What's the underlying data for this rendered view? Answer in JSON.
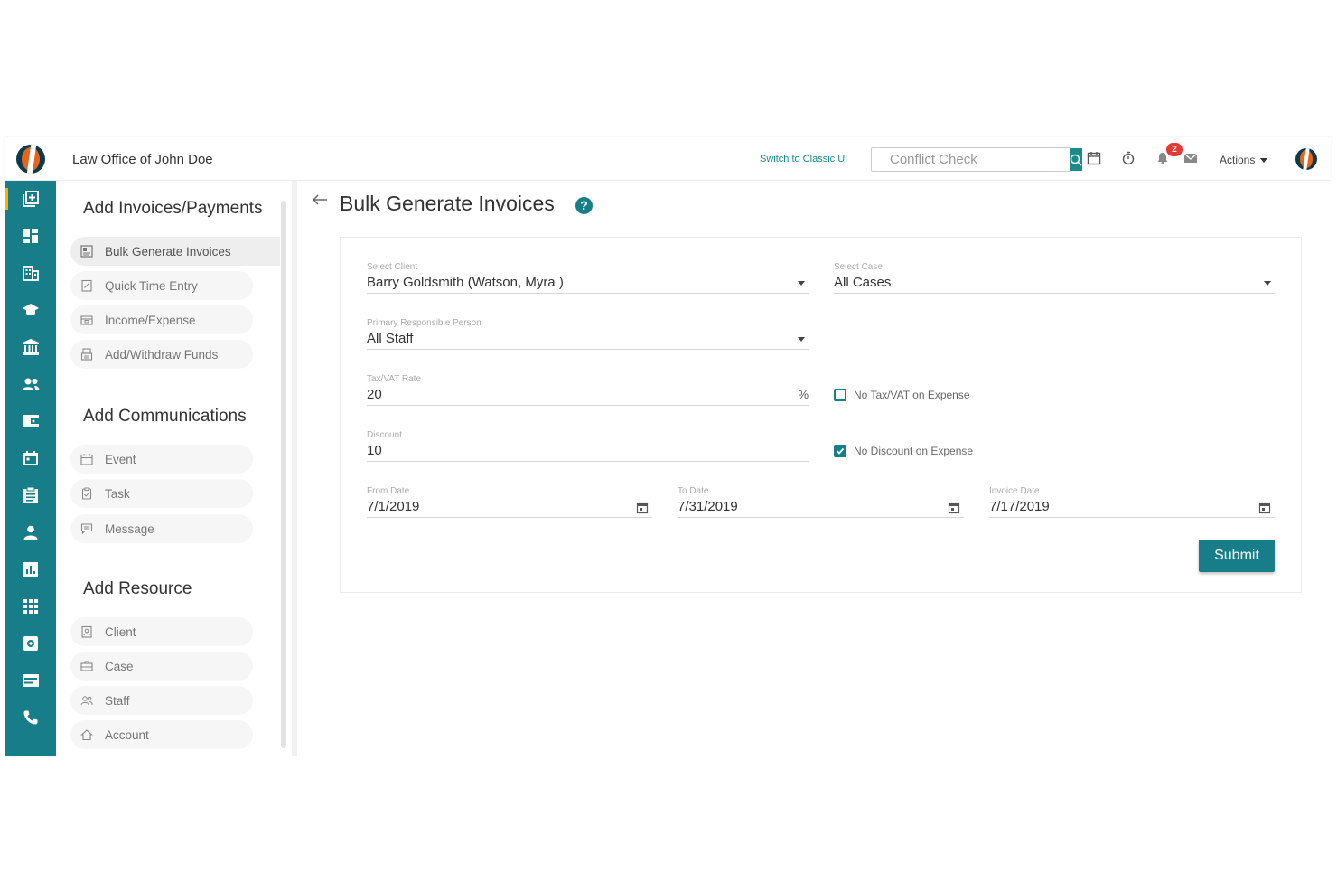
{
  "header": {
    "firm_name": "Law Office of John Doe",
    "switch_link": "Switch to Classic UI",
    "search_placeholder": "Conflict Check",
    "notification_count": "2",
    "actions_label": "Actions"
  },
  "rail": {
    "icons": [
      "add-record-icon",
      "dashboard-icon",
      "office-building-icon",
      "education-cap-icon",
      "bank-icon",
      "contacts-icon",
      "wallet-icon",
      "calendar-icon",
      "clipboard-icon",
      "person-icon",
      "analytics-chart-icon",
      "apps-grid-icon",
      "settings-box-icon",
      "card-icon",
      "phone-icon"
    ]
  },
  "left_panel": {
    "sections": [
      {
        "title": "Add Invoices/Payments",
        "items": [
          "Bulk Generate Invoices",
          "Quick Time Entry",
          "Income/Expense",
          "Add/Withdraw Funds"
        ]
      },
      {
        "title": "Add Communications",
        "items": [
          "Event",
          "Task",
          "Message"
        ]
      },
      {
        "title": "Add Resource",
        "items": [
          "Client",
          "Case",
          "Staff",
          "Account"
        ]
      }
    ]
  },
  "page": {
    "title": "Bulk Generate Invoices",
    "help": "?"
  },
  "form": {
    "client": {
      "label": "Select Client",
      "value": "Barry Goldsmith (Watson, Myra )"
    },
    "case": {
      "label": "Select Case",
      "value": "All Cases"
    },
    "responsible": {
      "label": "Primary Responsible Person",
      "value": "All Staff"
    },
    "tax": {
      "label": "Tax/VAT Rate",
      "value": "20",
      "unit": "%"
    },
    "no_tax": {
      "label": "No Tax/VAT on Expense",
      "checked": false
    },
    "discount": {
      "label": "Discount",
      "value": "10"
    },
    "no_discount": {
      "label": "No Discount on Expense",
      "checked": true
    },
    "from_date": {
      "label": "From Date",
      "value": "7/1/2019"
    },
    "to_date": {
      "label": "To Date",
      "value": "7/31/2019"
    },
    "invoice_date": {
      "label": "Invoice Date",
      "value": "7/17/2019"
    },
    "submit_label": "Submit"
  },
  "colors": {
    "accent": "#177e89",
    "brand_orange": "#e8641c",
    "badge_red": "#e53935",
    "active_marker": "#f5b400"
  }
}
